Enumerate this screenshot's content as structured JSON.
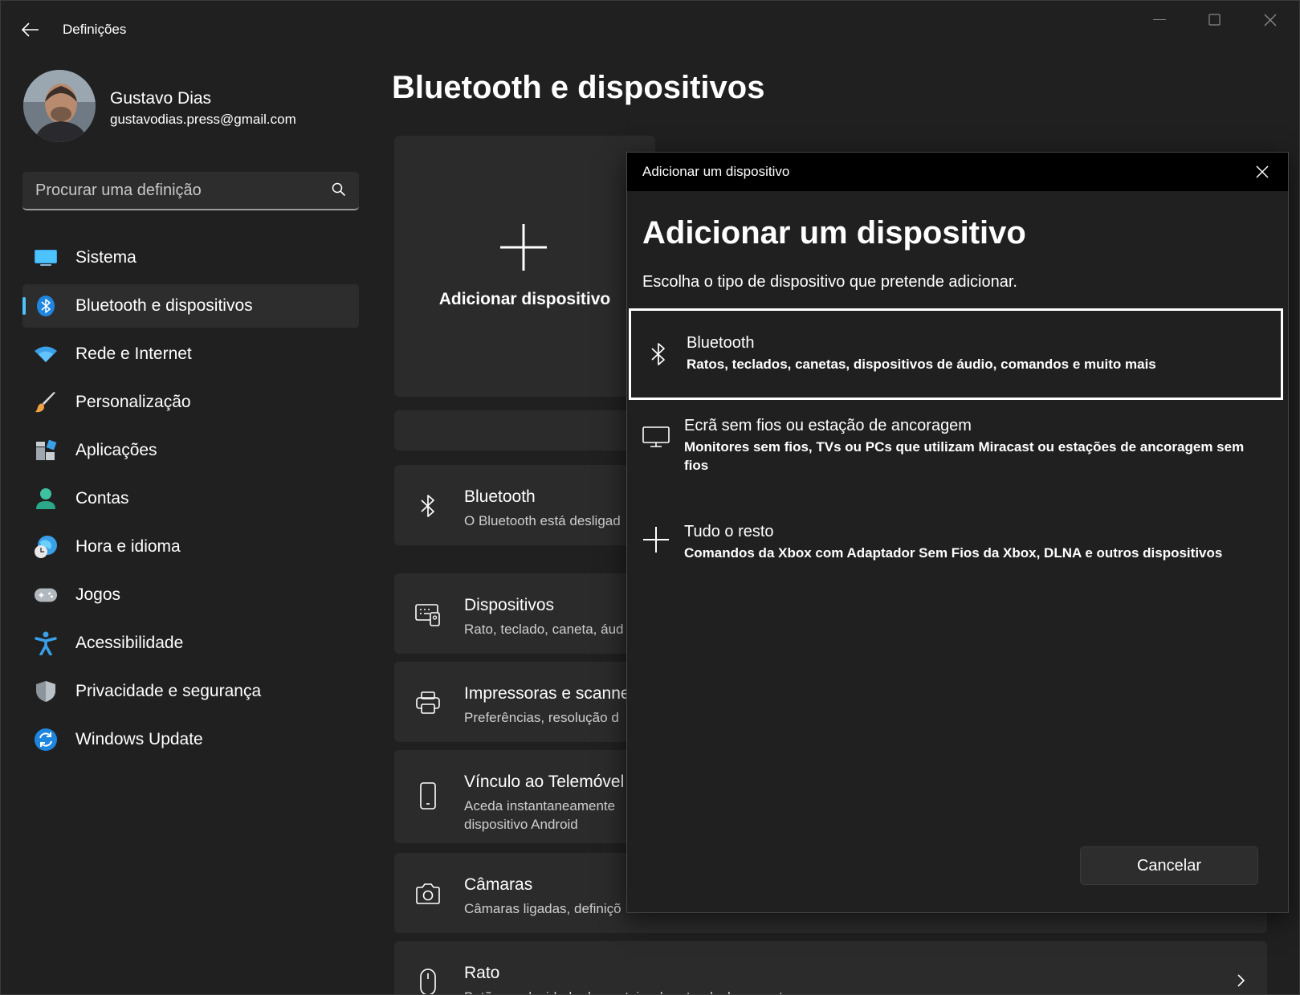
{
  "window": {
    "app_title": "Definições"
  },
  "profile": {
    "name": "Gustavo Dias",
    "email": "gustavodias.press@gmail.com"
  },
  "search": {
    "placeholder": "Procurar uma definição"
  },
  "sidebar": {
    "items": [
      {
        "label": "Sistema",
        "icon": "monitor-icon",
        "selected": false
      },
      {
        "label": "Bluetooth e dispositivos",
        "icon": "bluetooth-icon",
        "selected": true
      },
      {
        "label": "Rede e Internet",
        "icon": "wifi-icon",
        "selected": false
      },
      {
        "label": "Personalização",
        "icon": "brush-icon",
        "selected": false
      },
      {
        "label": "Aplicações",
        "icon": "apps-icon",
        "selected": false
      },
      {
        "label": "Contas",
        "icon": "person-icon",
        "selected": false
      },
      {
        "label": "Hora e idioma",
        "icon": "globe-clock-icon",
        "selected": false
      },
      {
        "label": "Jogos",
        "icon": "gamepad-icon",
        "selected": false
      },
      {
        "label": "Acessibilidade",
        "icon": "accessibility-icon",
        "selected": false
      },
      {
        "label": "Privacidade e segurança",
        "icon": "shield-icon",
        "selected": false
      },
      {
        "label": "Windows Update",
        "icon": "update-icon",
        "selected": false
      }
    ]
  },
  "main": {
    "title": "Bluetooth e dispositivos",
    "add_card_label": "Adicionar dispositivo",
    "rows": [
      {
        "title": "Bluetooth",
        "subtitle": "O Bluetooth está desligad"
      },
      {
        "title": "Dispositivos",
        "subtitle": "Rato, teclado, caneta, áud"
      },
      {
        "title": "Impressoras e scanner",
        "subtitle": "Preferências, resolução d"
      },
      {
        "title": "Vínculo ao Telemóvel",
        "subtitle": "Aceda instantaneamente",
        "subtitle2": "dispositivo Android"
      },
      {
        "title": "Câmaras",
        "subtitle": "Câmaras ligadas, definiçõ"
      },
      {
        "title": "Rato",
        "subtitle": "Botões, velocidade do ponteiro do rato, deslocamento"
      }
    ]
  },
  "dialog": {
    "bar_title": "Adicionar um dispositivo",
    "heading": "Adicionar um dispositivo",
    "subtitle": "Escolha o tipo de dispositivo que pretende adicionar.",
    "options": [
      {
        "title": "Bluetooth",
        "description": "Ratos, teclados, canetas, dispositivos de áudio, comandos e muito mais",
        "icon": "bluetooth-icon"
      },
      {
        "title": "Ecrã sem fios ou estação de ancoragem",
        "description": "Monitores sem fios, TVs ou PCs que utilizam Miracast ou estações de ancoragem sem fios",
        "icon": "monitor-icon"
      },
      {
        "title": "Tudo o resto",
        "description": "Comandos da Xbox com Adaptador Sem Fios da Xbox, DLNA e outros dispositivos",
        "icon": "plus-icon"
      }
    ],
    "cancel_label": "Cancelar"
  },
  "colors": {
    "background": "#202020",
    "card": "#2b2b2b",
    "accent": "#4cc2ff",
    "dialog_bar": "#000000"
  }
}
